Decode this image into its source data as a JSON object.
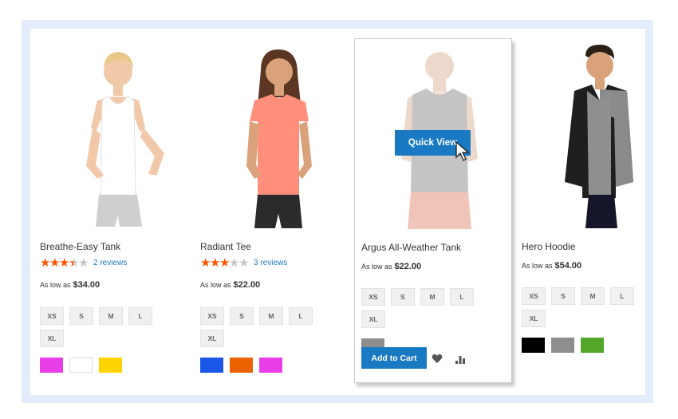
{
  "products": [
    {
      "name": "Breathe-Easy Tank",
      "rating": 3.5,
      "reviews": "2 reviews",
      "price_prefix": "As low as",
      "price": "$34.00",
      "sizes": [
        "XS",
        "S",
        "M",
        "L",
        "XL"
      ],
      "colors": [
        "#e83ee8",
        "#ffffff",
        "#ffd500"
      ],
      "image": "woman-white-tank-photo"
    },
    {
      "name": "Radiant Tee",
      "rating": 3,
      "reviews": "3 reviews",
      "price_prefix": "As low as",
      "price": "$22.00",
      "sizes": [
        "XS",
        "S",
        "M",
        "L",
        "XL"
      ],
      "colors": [
        "#1a56e8",
        "#eb6200",
        "#e83ee8"
      ],
      "image": "woman-coral-tee-photo"
    },
    {
      "name": "Argus All-Weather Tank",
      "price_prefix": "As low as",
      "price": "$22.00",
      "sizes": [
        "XS",
        "S",
        "M",
        "L",
        "XL"
      ],
      "colors": [
        "#8e8e8e"
      ],
      "image": "man-gray-tank-photo",
      "quick_view": "Quick View",
      "add_to_cart": "Add to Cart",
      "icons": [
        "heart-icon",
        "compare-bars-icon"
      ]
    },
    {
      "name": "Hero Hoodie",
      "price_prefix": "As low as",
      "price": "$54.00",
      "sizes": [
        "XS",
        "S",
        "M",
        "L",
        "XL"
      ],
      "colors": [
        "#000000",
        "#8e8e8e",
        "#53a728"
      ],
      "image": "man-gray-hoodie-photo"
    }
  ],
  "theme": {
    "accent": "#1979c3",
    "star_on": "#ff5501",
    "star_off": "#c7c7c7"
  }
}
